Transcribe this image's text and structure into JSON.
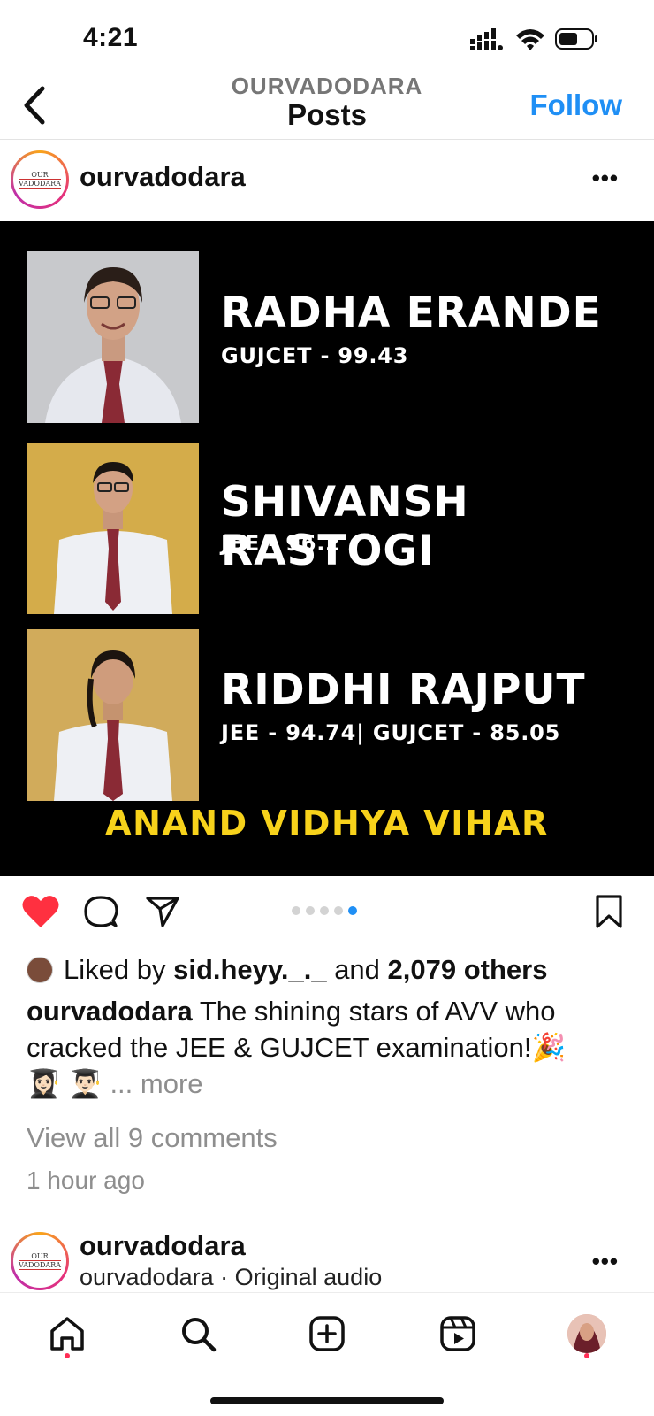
{
  "status": {
    "time": "4:21",
    "signal_icon": "cellular-signal-icon",
    "wifi_icon": "wifi-icon",
    "battery_icon": "battery-icon"
  },
  "header": {
    "account": "OURVADODARA",
    "title": "Posts",
    "follow_label": "Follow",
    "accent": "#1f8ff5"
  },
  "post": {
    "username": "ourvadodara",
    "logo_top": "OUR",
    "logo_bottom": "VADODARA",
    "students": [
      {
        "name": "RADHA ERANDE",
        "score": "GUJCET - 99.43"
      },
      {
        "name": "SHIVANSH RASTOGI",
        "score": "JEE - 96.2"
      },
      {
        "name": "RIDDHI RAJPUT",
        "score": "JEE - 94.74| GUJCET - 85.05"
      }
    ],
    "school": "ANAND VIDHYA VIHAR",
    "school_color": "#f7d21b"
  },
  "actions": {
    "like_icon": "heart-icon",
    "comment_icon": "comment-icon",
    "share_icon": "send-icon",
    "save_icon": "bookmark-icon",
    "carousel_count": 5,
    "carousel_active": 5,
    "liked_color": "#ff3040"
  },
  "likes": {
    "prefix": "Liked by",
    "user": "sid.heyy._._",
    "mid": "and",
    "count": "2,079 others"
  },
  "caption": {
    "user": "ourvadodara",
    "text": "The shining stars of AVV who cracked the JEE & GUJCET examination!🎉",
    "emojis": "👩🏻‍🎓 👨🏻‍🎓",
    "more": "... more"
  },
  "comments_label": "View all 9 comments",
  "time_ago": "1 hour ago",
  "next_post": {
    "username": "ourvadodara",
    "audio": "ourvadodara · Original audio"
  },
  "tabbar": {
    "home": "home-icon",
    "search": "search-icon",
    "create": "create-icon",
    "reels": "reels-icon",
    "profile": "profile-avatar"
  }
}
